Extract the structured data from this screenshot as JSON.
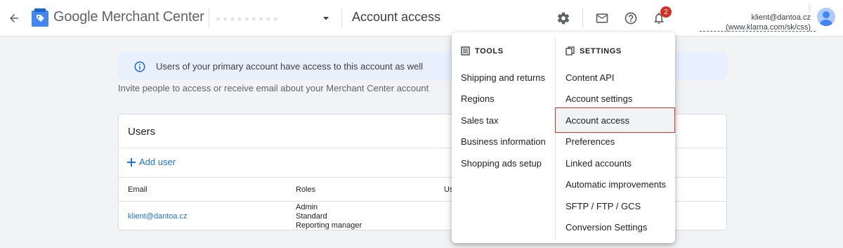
{
  "header": {
    "app_name_google": "Google",
    "app_name_rest": "Merchant Center",
    "account_selector_blurred": "▪ ▪ ▪ ▪ ▪ ▪ ▪ ▪ ▪",
    "page_title": "Account access",
    "notification_count": "2",
    "account_name_line": ")",
    "account_email": "klient@dantoa.cz",
    "account_url": "(www.klarna.com/sk/css)"
  },
  "banner": {
    "text": "Users of your primary account have access to this account as well"
  },
  "invite_text": "Invite people to access or receive email about your Merchant Center account",
  "users_card": {
    "title": "Users",
    "add_user": "Add user",
    "columns": {
      "email": "Email",
      "roles": "Roles",
      "third": "Us"
    },
    "row": {
      "email": "klient@dantoa.cz",
      "roles": [
        "Admin",
        "Standard",
        "Reporting manager"
      ]
    }
  },
  "menu": {
    "tools_heading": "TOOLS",
    "settings_heading": "SETTINGS",
    "tools": [
      "Shipping and returns",
      "Regions",
      "Sales tax",
      "Business information",
      "Shopping ads setup"
    ],
    "settings": [
      "Content API",
      "Account settings",
      "Account access",
      "Preferences",
      "Linked accounts",
      "Automatic improvements",
      "SFTP / FTP / GCS",
      "Conversion Settings"
    ]
  },
  "colors": {
    "accent": "#1a73e8",
    "badge": "#d93025",
    "selected_border": "#d93025",
    "banner_bg": "#e8f0fe"
  }
}
